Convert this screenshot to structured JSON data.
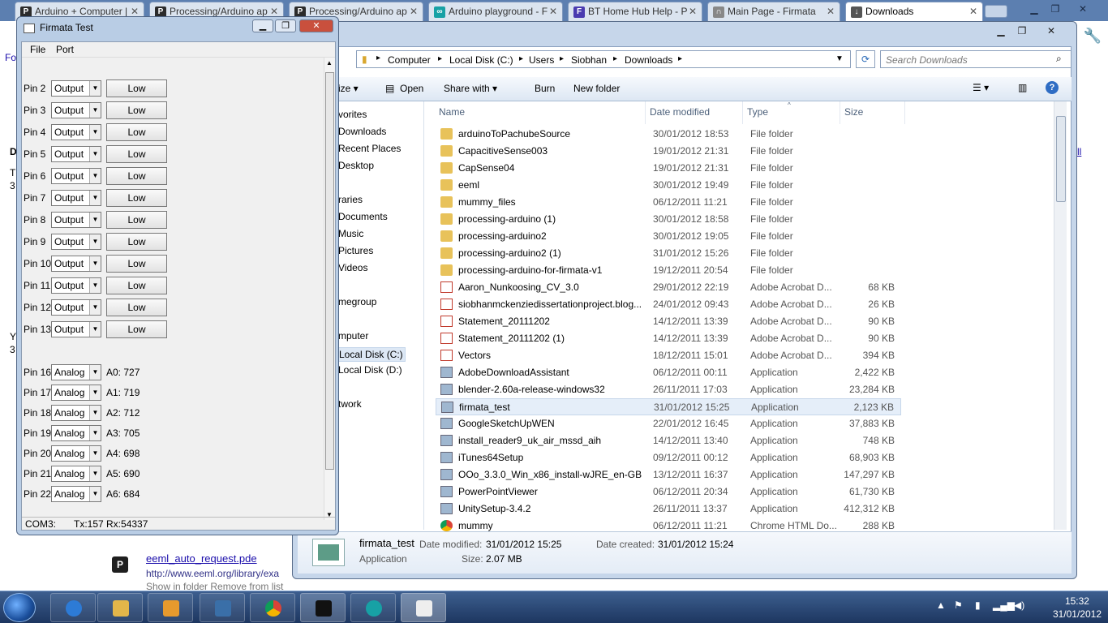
{
  "browser": {
    "tabs": [
      {
        "label": "Arduino + Computer |",
        "fav": "P",
        "favcolor": "#2b2b2b"
      },
      {
        "label": "Processing/Arduino ap",
        "fav": "P",
        "favcolor": "#2b2b2b"
      },
      {
        "label": "Processing/Arduino ap",
        "fav": "P",
        "favcolor": "#2b2b2b"
      },
      {
        "label": "Arduino playground - F",
        "fav": "∞",
        "favcolor": "#17a1a5"
      },
      {
        "label": "BT Home Hub Help - P",
        "fav": "F",
        "favcolor": "#4a3bb0"
      },
      {
        "label": "Main Page - Firmata",
        "fav": "∩",
        "favcolor": "#888888"
      },
      {
        "label": "Downloads",
        "fav": "↓",
        "favcolor": "#555555"
      }
    ],
    "left_fragments": [
      "Fo",
      "D",
      "T",
      "3",
      "Y",
      "3"
    ],
    "right_fragment": "ll",
    "downloads": {
      "item_name": "eeml_auto_request.pde",
      "item_url": "http://www.eeml.org/library/exa",
      "actions": "Show in folder    Remove from list"
    }
  },
  "explorer": {
    "breadcrumbs": [
      "Computer",
      "Local Disk (C:)",
      "Users",
      "Siobhan",
      "Downloads"
    ],
    "search_placeholder": "Search Downloads",
    "commands": [
      "ize ▾",
      "Open",
      "Share with ▾",
      "Burn",
      "New folder"
    ],
    "nav": [
      {
        "label": "vorites",
        "top": 0
      },
      {
        "label": "Downloads"
      },
      {
        "label": "Recent Places"
      },
      {
        "label": "Desktop"
      },
      {
        "label": "raries"
      },
      {
        "label": "Documents"
      },
      {
        "label": "Music"
      },
      {
        "label": "Pictures"
      },
      {
        "label": "Videos"
      },
      {
        "label": "megroup"
      },
      {
        "label": "mputer"
      },
      {
        "label": "Local Disk (C:)"
      },
      {
        "label": "Local Disk (D:)"
      },
      {
        "label": "twork"
      }
    ],
    "columns": [
      "Name",
      "Date modified",
      "Type",
      "Size"
    ],
    "files": [
      {
        "name": "arduinoToPachubeSource",
        "date": "30/01/2012 18:53",
        "type": "File folder",
        "size": "",
        "icon": "folder"
      },
      {
        "name": "CapacitiveSense003",
        "date": "19/01/2012 21:31",
        "type": "File folder",
        "size": "",
        "icon": "folder"
      },
      {
        "name": "CapSense04",
        "date": "19/01/2012 21:31",
        "type": "File folder",
        "size": "",
        "icon": "folder"
      },
      {
        "name": "eeml",
        "date": "30/01/2012 19:49",
        "type": "File folder",
        "size": "",
        "icon": "folder"
      },
      {
        "name": "mummy_files",
        "date": "06/12/2011 11:21",
        "type": "File folder",
        "size": "",
        "icon": "folder"
      },
      {
        "name": "processing-arduino (1)",
        "date": "30/01/2012 18:58",
        "type": "File folder",
        "size": "",
        "icon": "folder"
      },
      {
        "name": "processing-arduino2",
        "date": "30/01/2012 19:05",
        "type": "File folder",
        "size": "",
        "icon": "folder"
      },
      {
        "name": "processing-arduino2 (1)",
        "date": "31/01/2012 15:26",
        "type": "File folder",
        "size": "",
        "icon": "folder"
      },
      {
        "name": "processing-arduino-for-firmata-v1",
        "date": "19/12/2011 20:54",
        "type": "File folder",
        "size": "",
        "icon": "folder"
      },
      {
        "name": "Aaron_Nunkoosing_CV_3.0",
        "date": "29/01/2012 22:19",
        "type": "Adobe Acrobat D...",
        "size": "68 KB",
        "icon": "pdf"
      },
      {
        "name": "siobhanmckenziedissertationproject.blog...",
        "date": "24/01/2012 09:43",
        "type": "Adobe Acrobat D...",
        "size": "26 KB",
        "icon": "pdf"
      },
      {
        "name": "Statement_20111202",
        "date": "14/12/2011 13:39",
        "type": "Adobe Acrobat D...",
        "size": "90 KB",
        "icon": "pdf"
      },
      {
        "name": "Statement_20111202 (1)",
        "date": "14/12/2011 13:39",
        "type": "Adobe Acrobat D...",
        "size": "90 KB",
        "icon": "pdf"
      },
      {
        "name": "Vectors",
        "date": "18/12/2011 15:01",
        "type": "Adobe Acrobat D...",
        "size": "394 KB",
        "icon": "pdf"
      },
      {
        "name": "AdobeDownloadAssistant",
        "date": "06/12/2011 00:11",
        "type": "Application",
        "size": "2,422 KB",
        "icon": "app"
      },
      {
        "name": "blender-2.60a-release-windows32",
        "date": "26/11/2011 17:03",
        "type": "Application",
        "size": "23,284 KB",
        "icon": "app"
      },
      {
        "name": "firmata_test",
        "date": "31/01/2012 15:25",
        "type": "Application",
        "size": "2,123 KB",
        "icon": "app",
        "selected": true
      },
      {
        "name": "GoogleSketchUpWEN",
        "date": "22/01/2012 16:45",
        "type": "Application",
        "size": "37,883 KB",
        "icon": "app"
      },
      {
        "name": "install_reader9_uk_air_mssd_aih",
        "date": "14/12/2011 13:40",
        "type": "Application",
        "size": "748 KB",
        "icon": "app"
      },
      {
        "name": "iTunes64Setup",
        "date": "09/12/2011 00:12",
        "type": "Application",
        "size": "68,903 KB",
        "icon": "app"
      },
      {
        "name": "OOo_3.3.0_Win_x86_install-wJRE_en-GB",
        "date": "13/12/2011 16:37",
        "type": "Application",
        "size": "147,297 KB",
        "icon": "app"
      },
      {
        "name": "PowerPointViewer",
        "date": "06/12/2011 20:34",
        "type": "Application",
        "size": "61,730 KB",
        "icon": "app"
      },
      {
        "name": "UnitySetup-3.4.2",
        "date": "26/11/2011 13:37",
        "type": "Application",
        "size": "412,312 KB",
        "icon": "app"
      },
      {
        "name": "mummy",
        "date": "06/12/2011 11:21",
        "type": "Chrome HTML Do...",
        "size": "288 KB",
        "icon": "chrome"
      }
    ],
    "details": {
      "name": "firmata_test",
      "kind": "Application",
      "modified_label": "Date modified:",
      "modified": "31/01/2012 15:25",
      "created_label": "Date created:",
      "created": "31/01/2012 15:24",
      "size_label": "Size:",
      "size": "2.07 MB"
    }
  },
  "firmata": {
    "title": "Firmata Test",
    "menu": [
      "File",
      "Port"
    ],
    "digital_pins": [
      {
        "pin": "Pin 2",
        "mode": "Output",
        "button": "Low"
      },
      {
        "pin": "Pin 3",
        "mode": "Output",
        "button": "Low"
      },
      {
        "pin": "Pin 4",
        "mode": "Output",
        "button": "Low"
      },
      {
        "pin": "Pin 5",
        "mode": "Output",
        "button": "Low"
      },
      {
        "pin": "Pin 6",
        "mode": "Output",
        "button": "Low"
      },
      {
        "pin": "Pin 7",
        "mode": "Output",
        "button": "Low"
      },
      {
        "pin": "Pin 8",
        "mode": "Output",
        "button": "Low"
      },
      {
        "pin": "Pin 9",
        "mode": "Output",
        "button": "Low"
      },
      {
        "pin": "Pin 10",
        "mode": "Output",
        "button": "Low"
      },
      {
        "pin": "Pin 11",
        "mode": "Output",
        "button": "Low"
      },
      {
        "pin": "Pin 12",
        "mode": "Output",
        "button": "Low"
      },
      {
        "pin": "Pin 13",
        "mode": "Output",
        "button": "Low"
      }
    ],
    "analog_pins": [
      {
        "pin": "Pin 16",
        "mode": "Analog",
        "value": "A0: 727"
      },
      {
        "pin": "Pin 17",
        "mode": "Analog",
        "value": "A1: 719"
      },
      {
        "pin": "Pin 18",
        "mode": "Analog",
        "value": "A2: 712"
      },
      {
        "pin": "Pin 19",
        "mode": "Analog",
        "value": "A3: 705"
      },
      {
        "pin": "Pin 20",
        "mode": "Analog",
        "value": "A4: 698"
      },
      {
        "pin": "Pin 21",
        "mode": "Analog",
        "value": "A5: 690"
      },
      {
        "pin": "Pin 22",
        "mode": "Analog",
        "value": "A6: 684"
      }
    ],
    "status": {
      "port": "COM3:",
      "traffic": "Tx:157 Rx:54337"
    }
  },
  "taskbar": {
    "clock_time": "15:32",
    "clock_date": "31/01/2012"
  }
}
